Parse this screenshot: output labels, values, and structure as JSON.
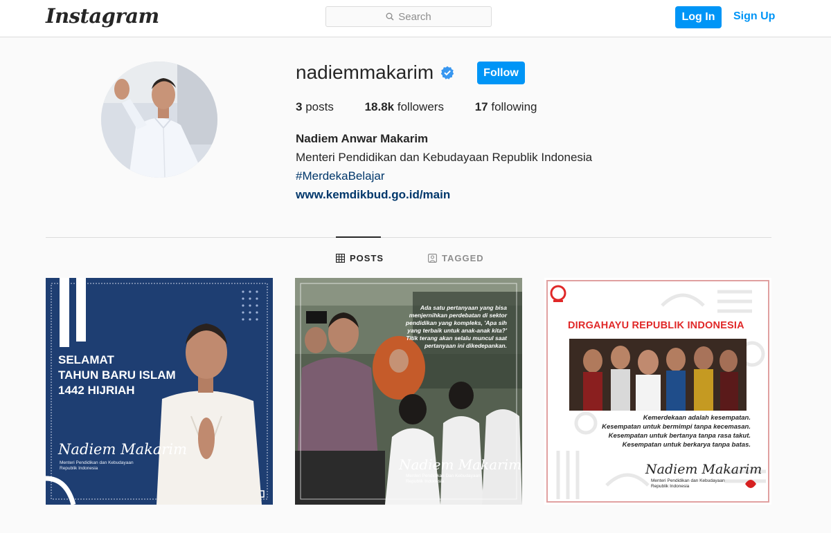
{
  "header": {
    "logo": "Instagram",
    "search_placeholder": "Search",
    "login_label": "Log In",
    "signup_label": "Sign Up"
  },
  "profile": {
    "username": "nadiemmakarim",
    "follow_label": "Follow",
    "stats": {
      "posts_count": "3",
      "posts_label": "posts",
      "followers_count": "18.8k",
      "followers_label": "followers",
      "following_count": "17",
      "following_label": "following"
    },
    "full_name": "Nadiem Anwar Makarim",
    "bio": "Menteri Pendidikan dan Kebudayaan Republik Indonesia",
    "hashtag": "#MerdekaBelajar",
    "website": "www.kemdikbud.go.id/main"
  },
  "tabs": {
    "posts_label": "POSTS",
    "tagged_label": "TAGGED",
    "active": "posts"
  },
  "posts": [
    {
      "title_lines": [
        "SELAMAT",
        "TAHUN BARU ISLAM",
        "1442 HIJRIAH"
      ],
      "signature": "Nadiem Makarim",
      "signature_sub": "Menteri Pendidikan dan Kebudayaan Republik Indonesia"
    },
    {
      "quote": "Ada satu pertanyaan yang bisa menjernihkan perdebatan di sektor pendidikan yang kompleks, 'Apa sih yang terbaik untuk anak-anak kita?' Titik terang akan selalu muncul saat pertanyaan ini dikedepankan.",
      "signature": "Nadiem Makarim",
      "signature_sub": "Menteri Pendidikan Dan Kebudayaan Republik Indonesia"
    },
    {
      "title": "DIRGAHAYU REPUBLIK INDONESIA",
      "quote_lines": [
        "Kemerdekaan adalah kesempatan.",
        "Kesempatan untuk bermimpi tanpa kecemasan.",
        "Kesempatan untuk bertanya tanpa rasa takut.",
        "Kesempatan untuk berkarya tanpa batas."
      ],
      "signature": "Nadiem Makarim",
      "signature_sub": "Menteri Pendidikan dan Kebudayaan Republik Indonesia"
    }
  ],
  "colors": {
    "accent": "#0095f6",
    "link": "#00376b",
    "post1_bg": "#1e3e72",
    "post3_title": "#e02828"
  },
  "icons": [
    "search-icon",
    "verified-badge-icon",
    "grid-icon",
    "tagged-icon"
  ]
}
